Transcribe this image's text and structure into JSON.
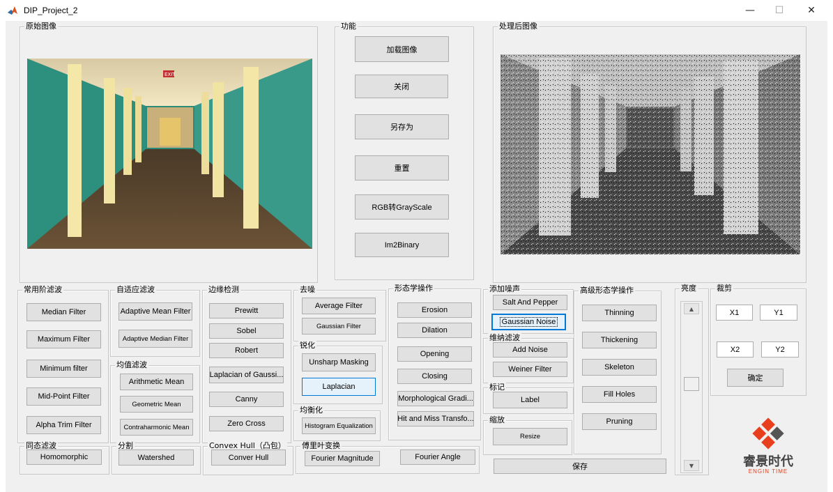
{
  "window": {
    "title": "DIP_Project_2",
    "minimize": "—",
    "maximize": "☐",
    "close": "✕"
  },
  "panels": {
    "original": "原始图像",
    "functions": "功能",
    "processed": "处理后图像",
    "common_filter": "常用阶滤波",
    "adaptive_filter": "自适应滤波",
    "mean_filter": "均值滤波",
    "edge": "边缘检测",
    "denoise": "去噪",
    "sharpen": "锐化",
    "equalize": "均衡化",
    "morph": "形态学操作",
    "add_noise": "添加噪声",
    "wiener": "维纳滤波",
    "label": "标记",
    "scale": "缩放",
    "adv_morph": "高级形态学操作",
    "brightness": "亮度",
    "crop": "裁剪",
    "homomorphic": "同态滤波",
    "segment": "分割",
    "convex": "Convex Hull（凸包）",
    "fourier": "傅里叶变换"
  },
  "buttons": {
    "load": "加载图像",
    "close": "关闭",
    "save_as": "另存为",
    "reset": "重置",
    "rgb2gray": "RGB转GrayScale",
    "im2binary": "Im2Binary",
    "median": "Median Filter",
    "maximum": "Maximum Filter",
    "minimum": "Minimum filter",
    "midpoint": "Mid-Point Filter",
    "alpha_trim": "Alpha Trim Filter",
    "adaptive_mean": "Adaptive Mean Filter",
    "adaptive_median": "Adaptive Median Filter",
    "arith_mean": "Arithmetic Mean",
    "geo_mean": "Geometric Mean",
    "contra_mean": "Contraharmonic Mean",
    "prewitt": "Prewitt",
    "sobel": "Sobel",
    "robert": "Robert",
    "log": "Laplacian of Gaussi...",
    "canny": "Canny",
    "zero_cross": "Zero Cross",
    "avg_filter": "Average Filter",
    "gauss_filter": "Gaussian Filter",
    "unsharp": "Unsharp Masking",
    "laplacian": "Laplacian",
    "hist_eq": "Histogram Equalization",
    "erosion": "Erosion",
    "dilation": "Dilation",
    "opening": "Opening",
    "closing": "Closing",
    "morph_grad": "Morphological Gradi...",
    "hit_miss": "Hit and Miss Transfo...",
    "salt_pepper": "Salt And Pepper",
    "gauss_noise": "Gaussian Noise",
    "add_noise": "Add Noise",
    "weiner": "Weiner Filter",
    "label": "Label",
    "resize": "Resize",
    "thinning": "Thinning",
    "thickening": "Thickening",
    "skeleton": "Skeleton",
    "fill_holes": "Fill Holes",
    "pruning": "Pruning",
    "x1": "X1",
    "y1": "Y1",
    "x2": "X2",
    "y2": "Y2",
    "confirm": "确定",
    "homomorphic": "Homomorphic",
    "watershed": "Watershed",
    "conver_hull": "Conver Hull",
    "fourier_mag": "Fourier Magnitude",
    "fourier_angle": "Fourier Angle",
    "save": "保存"
  },
  "slider": {
    "up": "▲",
    "down": "▼",
    "value_fraction": 0.47
  },
  "logo": {
    "name": "睿景时代",
    "sub": "ENGIN TIME",
    "color": "#e8401c"
  },
  "colors": {
    "accent": "#0078d7",
    "panel_bg": "#f0f0f0"
  }
}
